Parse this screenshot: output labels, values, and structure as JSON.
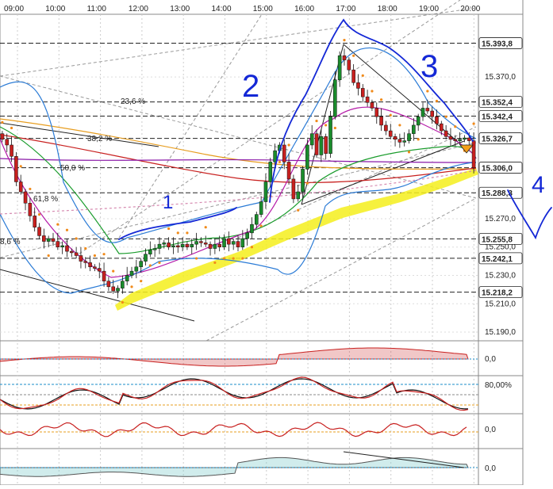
{
  "chart_data": {
    "type": "candlestick",
    "x_labels": [
      "09:00",
      "10:00",
      "11:00",
      "12:00",
      "13:00",
      "14:00",
      "15:00",
      "16:00",
      "17:00",
      "18:00",
      "19:00",
      "20:00"
    ],
    "price_ticks": [
      "15.370,0",
      "15.270,0",
      "15.250,0",
      "15.230,0",
      "15.210,0",
      "15.190,0"
    ],
    "price_ticks_y": [
      15370,
      15270,
      15250,
      15230,
      15210,
      15190
    ],
    "price_labels": [
      {
        "text": "15.393,8",
        "value": 15393.8
      },
      {
        "text": "15.352,4",
        "value": 15352.4
      },
      {
        "text": "15.342,4",
        "value": 15342.4
      },
      {
        "text": "15.326,7",
        "value": 15326.7
      },
      {
        "text": "15.306,0",
        "value": 15306.0
      },
      {
        "text": "15.288,3",
        "value": 15288.3
      },
      {
        "text": "15.255,8",
        "value": 15255.8
      },
      {
        "text": "15.242,1",
        "value": 15242.1
      },
      {
        "text": "15.218,2",
        "value": 15218.2
      }
    ],
    "fib_labels": [
      "23,6 %",
      "38,2 %",
      "50,0 %",
      "61,8 %",
      "8,6 %"
    ],
    "annotations": [
      "1",
      "2",
      "3",
      "4"
    ],
    "indicator_labels": [
      "0,0",
      "80,00%",
      "0,0",
      "0,0"
    ],
    "close": [
      15326,
      15322,
      15314,
      15296,
      15289,
      15281,
      15272,
      15264,
      15258,
      15254,
      15256,
      15254,
      15250,
      15251,
      15247,
      15246,
      15244,
      15240,
      15239,
      15236,
      15235,
      15233,
      15226,
      15222,
      15219,
      15221,
      15226,
      15230,
      15233,
      15236,
      15240,
      15245,
      15248,
      15249,
      15252,
      15253,
      15250,
      15251,
      15250,
      15252,
      15250,
      15252,
      15254,
      15253,
      15252,
      15249,
      15252,
      15250,
      15256,
      15252,
      15254,
      15250,
      15256,
      15260,
      15266,
      15273,
      15282,
      15296,
      15310,
      15318,
      15322,
      15310,
      15298,
      15284,
      15289,
      15305,
      15322,
      15330,
      15315,
      15328,
      15316,
      15342,
      15368,
      15385,
      15382,
      15375,
      15366,
      15362,
      15356,
      15352,
      15348,
      15342,
      15336,
      15332,
      15328,
      15326,
      15324,
      15325,
      15330,
      15336,
      15342,
      15348,
      15346,
      15342,
      15337,
      15332,
      15328,
      15326,
      15325,
      15326,
      15327,
      15325,
      15306
    ],
    "colors": {
      "up": "#1a8c2c",
      "down": "#c8201f",
      "highlight": "#f5ee1c",
      "annotation": "#1428d6"
    }
  }
}
